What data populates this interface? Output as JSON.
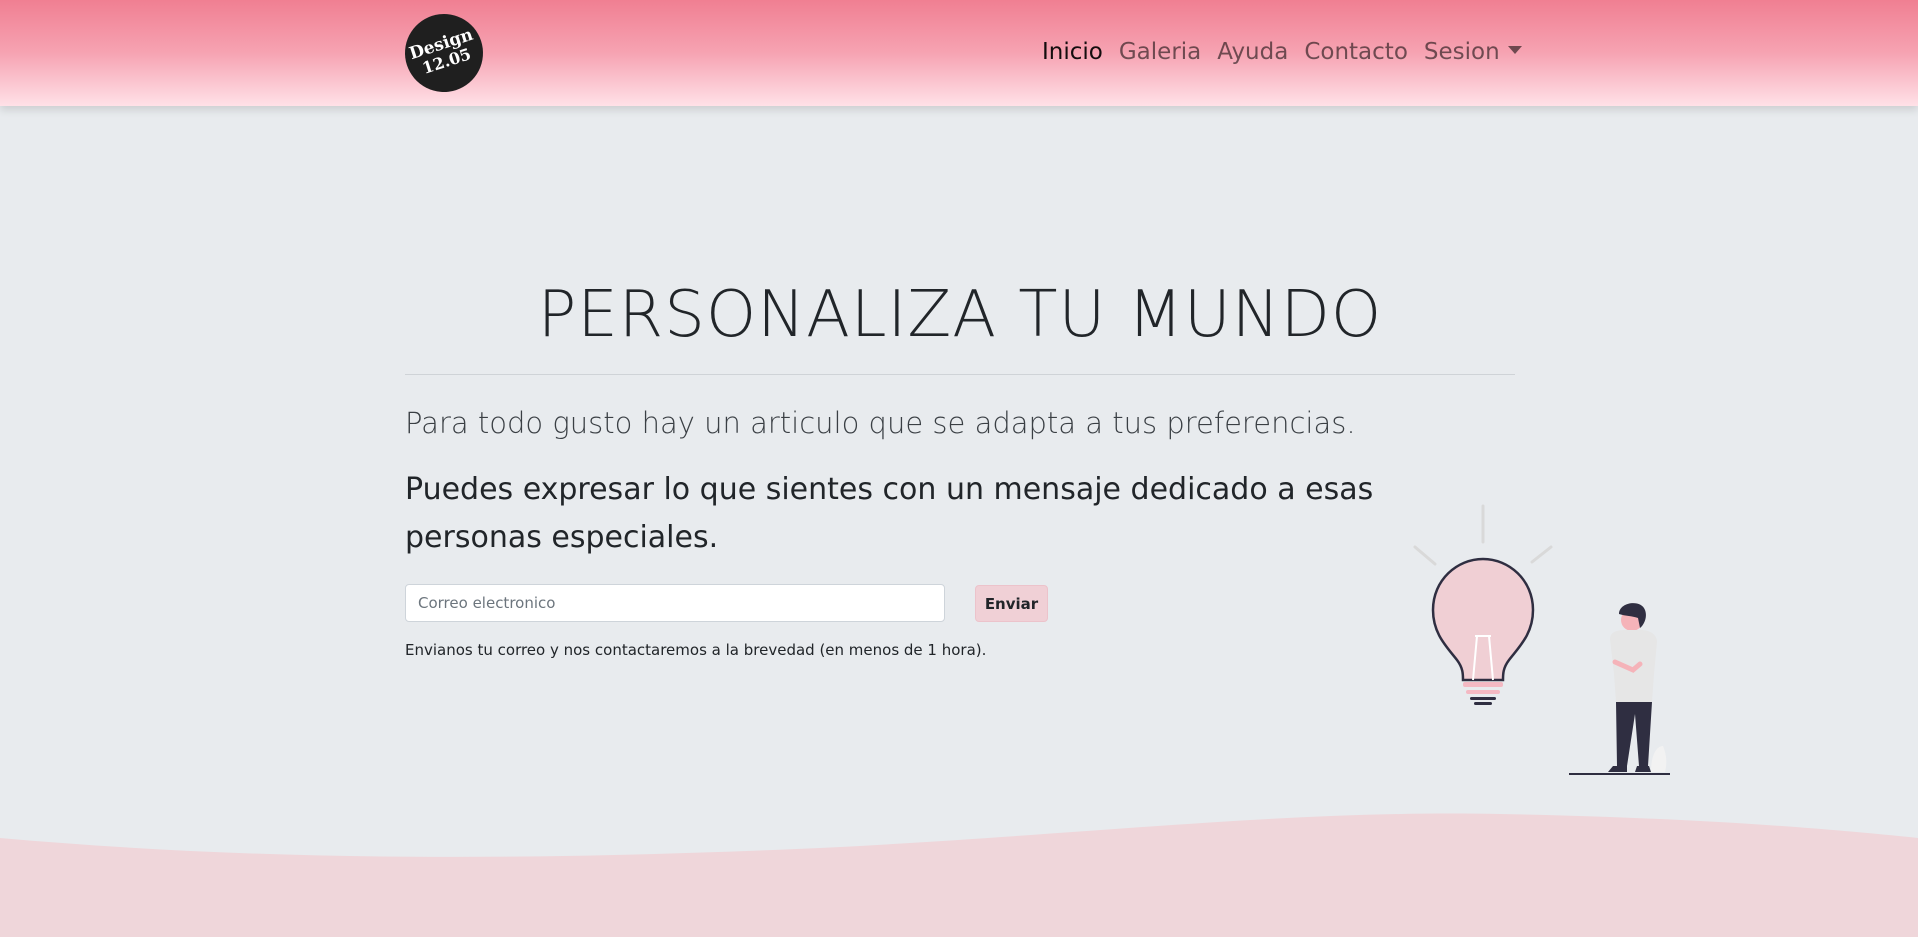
{
  "brand": {
    "logo_line1": "Design",
    "logo_line2": "12.05"
  },
  "nav": {
    "items": [
      {
        "label": "Inicio"
      },
      {
        "label": "Galeria"
      },
      {
        "label": "Ayuda"
      },
      {
        "label": "Contacto"
      },
      {
        "label": "Sesion"
      }
    ]
  },
  "hero": {
    "title": "PERSONALIZA TU MUNDO",
    "lead": "Para todo gusto hay un articulo que se adapta a tus preferencias.",
    "subtitle": "Puedes expresar lo que sientes con un mensaje dedicado a esas personas especiales."
  },
  "form": {
    "email_placeholder": "Correo electronico",
    "email_value": "",
    "submit_label": "Enviar",
    "help_text": "Envianos tu correo y nos contactaremos a la brevedad (en menos de 1 hora)."
  },
  "colors": {
    "navbar_top": "#f07f92",
    "navbar_bottom": "#ffe1e7",
    "background": "#e8ebee",
    "wave": "#efd6da",
    "button": "#f0d0d6",
    "illustration_accent": "#f0c8cf",
    "illustration_dark": "#2f2e41"
  },
  "illustration": {
    "name": "lightbulb-person-illustration"
  }
}
